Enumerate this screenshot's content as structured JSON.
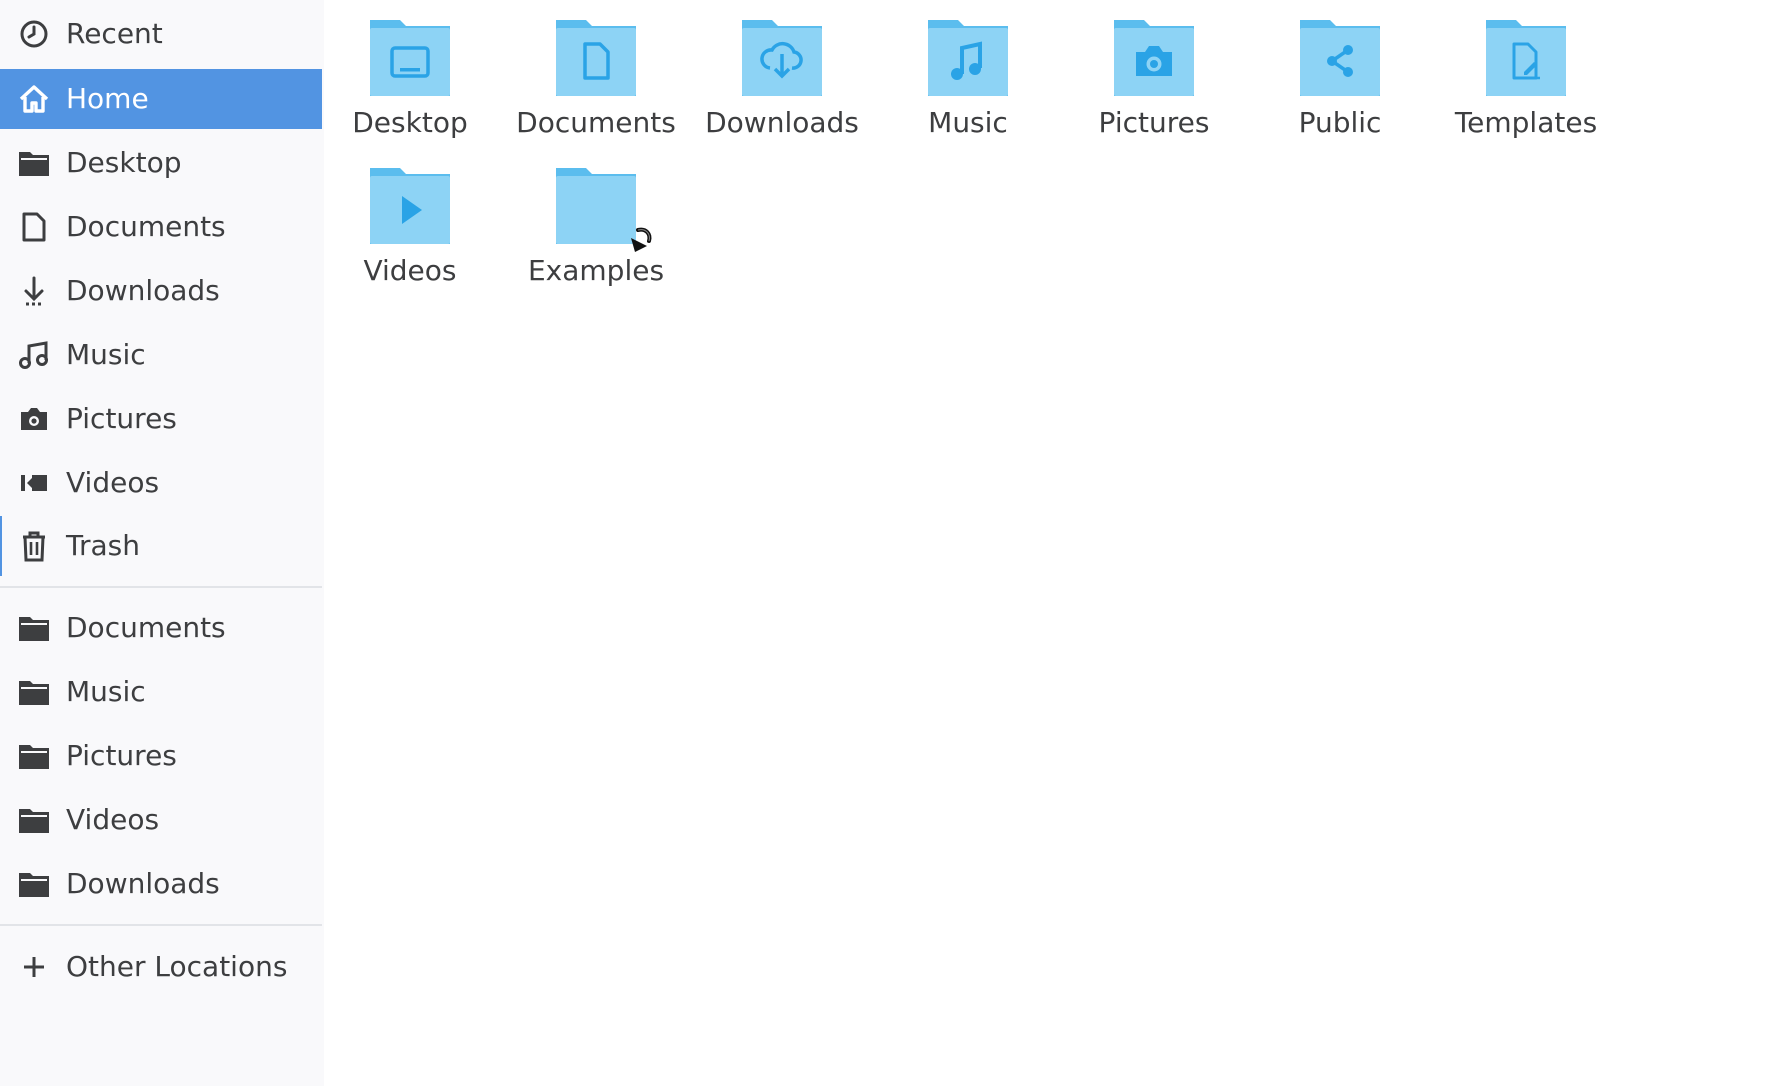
{
  "sidebar": {
    "items": [
      {
        "label": "Recent",
        "icon": "clock-icon"
      },
      {
        "label": "Home",
        "icon": "home-icon",
        "active": true
      },
      {
        "label": "Desktop",
        "icon": "folder-icon"
      },
      {
        "label": "Documents",
        "icon": "document-icon"
      },
      {
        "label": "Downloads",
        "icon": "download-icon"
      },
      {
        "label": "Music",
        "icon": "music-icon"
      },
      {
        "label": "Pictures",
        "icon": "camera-icon"
      },
      {
        "label": "Videos",
        "icon": "video-icon"
      },
      {
        "label": "Trash",
        "icon": "trash-icon"
      }
    ],
    "bookmarks": [
      {
        "label": "Documents",
        "icon": "folder-icon"
      },
      {
        "label": "Music",
        "icon": "folder-icon"
      },
      {
        "label": "Pictures",
        "icon": "folder-icon"
      },
      {
        "label": "Videos",
        "icon": "folder-icon"
      },
      {
        "label": "Downloads",
        "icon": "folder-icon"
      }
    ],
    "other_locations": {
      "label": "Other Locations",
      "icon": "plus-icon"
    }
  },
  "folders": [
    {
      "label": "Desktop",
      "emblem": "desktop-emblem-icon"
    },
    {
      "label": "Documents",
      "emblem": "document-emblem-icon"
    },
    {
      "label": "Downloads",
      "emblem": "download-emblem-icon"
    },
    {
      "label": "Music",
      "emblem": "music-emblem-icon"
    },
    {
      "label": "Pictures",
      "emblem": "camera-emblem-icon"
    },
    {
      "label": "Public",
      "emblem": "share-emblem-icon"
    },
    {
      "label": "Templates",
      "emblem": "template-emblem-icon"
    },
    {
      "label": "Videos",
      "emblem": "play-emblem-icon"
    },
    {
      "label": "Examples",
      "emblem": "symlink-arrow-icon"
    }
  ],
  "colors": {
    "accent": "#5294e2",
    "folder_light": "#8dd3f5",
    "folder_dark": "#5bbdee",
    "emblem": "#2aa3e6",
    "text": "#3d3e40",
    "sidebar_bg": "#f9f9fb"
  }
}
